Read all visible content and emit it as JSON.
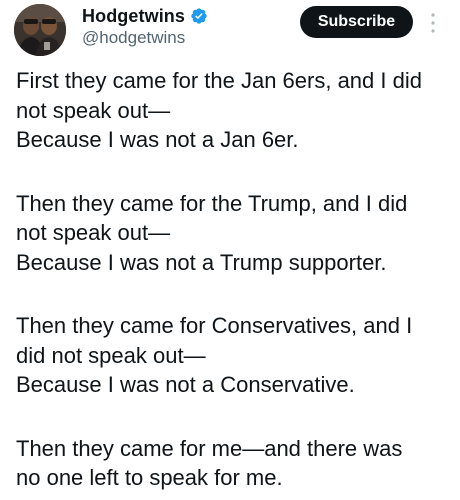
{
  "author": {
    "display_name": "Hodgetwins",
    "handle": "@hodgetwins",
    "verified_icon": "verified-badge-icon",
    "verified_color": "#1d9bf0"
  },
  "actions": {
    "subscribe_label": "Subscribe",
    "more_icon": "more-vertical-icon"
  },
  "tweet": {
    "stanzas": [
      {
        "lines": [
          "First they came for the Jan 6ers, and I did",
          "not speak out—",
          "Because I was not a Jan 6er."
        ]
      },
      {
        "lines": [
          "Then they came for the Trump, and I did",
          "not speak out—",
          "Because I was not a Trump supporter."
        ]
      },
      {
        "lines": [
          "Then they came for Conservatives, and I",
          "did not speak out—",
          "Because I was not a Conservative."
        ]
      },
      {
        "lines": [
          "Then they came for me—and there was",
          "no one left to speak for me."
        ]
      }
    ]
  }
}
